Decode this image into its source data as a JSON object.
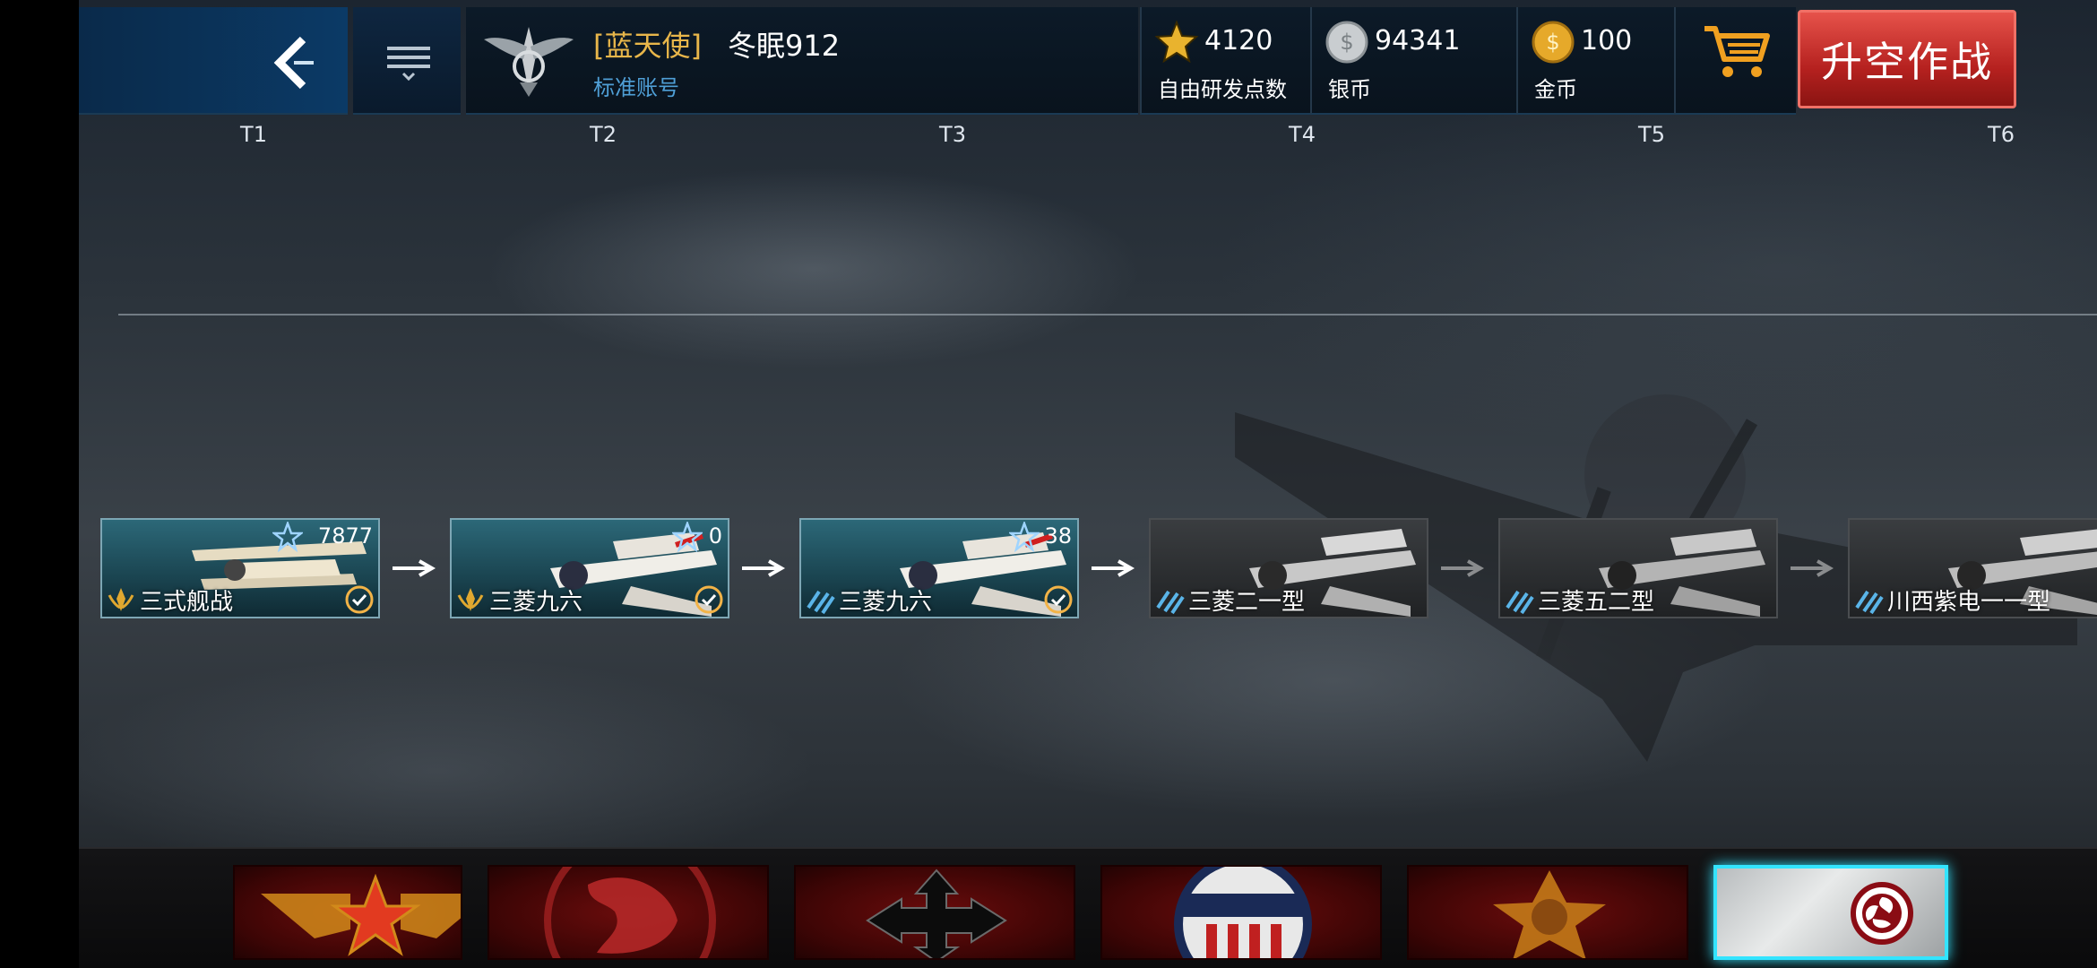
{
  "topbar": {
    "player": {
      "tag": "[蓝天使]",
      "name": "冬眠912",
      "account_type": "标准账号"
    },
    "currencies": [
      {
        "id": "free-research",
        "value": "4120",
        "label": "自由研发点数",
        "icon": "star-icon"
      },
      {
        "id": "silver",
        "value": "94341",
        "label": "银币",
        "icon": "silver-coin-icon"
      },
      {
        "id": "gold",
        "value": "100",
        "label": "金币",
        "icon": "gold-coin-icon"
      }
    ],
    "fight_button": "升空作战"
  },
  "tiers": [
    "T1",
    "T2",
    "T3",
    "T4",
    "T5",
    "T6"
  ],
  "aircraft": [
    {
      "name": "三式舰战",
      "exp": "7877",
      "status": "researched",
      "rank_icon": "gold-wings-icon"
    },
    {
      "name": "三菱九六",
      "exp": "0",
      "status": "researched",
      "rank_icon": "gold-wings-icon"
    },
    {
      "name": "三菱九六",
      "exp": "38",
      "status": "researched",
      "rank_icon": "blue-stripes-icon"
    },
    {
      "name": "三菱二一型",
      "exp": "",
      "status": "locked",
      "rank_icon": "blue-stripes-icon"
    },
    {
      "name": "三菱五二型",
      "exp": "",
      "status": "locked",
      "rank_icon": "blue-stripes-icon"
    },
    {
      "name": "川西紫电一一型",
      "exp": "",
      "status": "locked",
      "rank_icon": "blue-stripes-icon"
    }
  ],
  "nations": [
    {
      "id": "ussr",
      "icon": "red-star-wings-icon",
      "active": false
    },
    {
      "id": "uk",
      "icon": "lion-emblem-icon",
      "active": false
    },
    {
      "id": "germany",
      "icon": "cross-arrows-icon",
      "active": false
    },
    {
      "id": "usa",
      "icon": "stars-stripes-shield-icon",
      "active": false
    },
    {
      "id": "china",
      "icon": "bear-star-icon",
      "active": false
    },
    {
      "id": "japan",
      "icon": "mitsudomoe-icon",
      "active": true
    }
  ],
  "colors": {
    "accent_gold": "#e8b64a",
    "accent_blue": "#4f9fd6",
    "fight_red": "#c22a25",
    "active_cyan": "#33e4ff"
  }
}
